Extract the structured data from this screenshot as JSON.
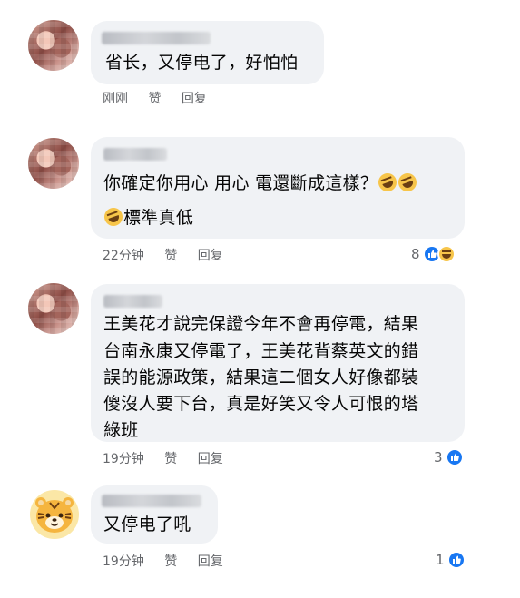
{
  "comments": [
    {
      "text": "省长，又停电了，好怕怕",
      "time": "刚刚",
      "like": "赞",
      "reply": "回复"
    },
    {
      "text_line1": "你確定你用心 用心 電還斷成這樣？",
      "text_line2": "標準真低",
      "emoji_icons": [
        "rolling-laugh-icon",
        "rolling-laugh-icon",
        "rolling-laugh-icon"
      ],
      "time": "22分钟",
      "like": "赞",
      "reply": "回复",
      "reaction_count": "8",
      "reaction_icons": [
        "like-icon",
        "haha-icon"
      ]
    },
    {
      "lines": [
        "王美花才說完保證今年不會再停電，結果",
        "台南永康又停電了，王美花背蔡英文的錯",
        "誤的能源政策，結果這二個女人好像都裝",
        "傻沒人要下台，真是好笑又令人可恨的塔",
        "綠班"
      ],
      "time": "19分钟",
      "like": "赞",
      "reply": "回复",
      "reaction_count": "3",
      "reaction_icons": [
        "like-icon"
      ]
    },
    {
      "text": "又停电了吼",
      "time": "19分钟",
      "like": "赞",
      "reply": "回复",
      "reaction_count": "1",
      "reaction_icons": [
        "like-icon"
      ]
    }
  ],
  "colors": {
    "bubble": "#f0f2f5",
    "meta_text": "#65676b",
    "like_blue": "#1877f2"
  }
}
